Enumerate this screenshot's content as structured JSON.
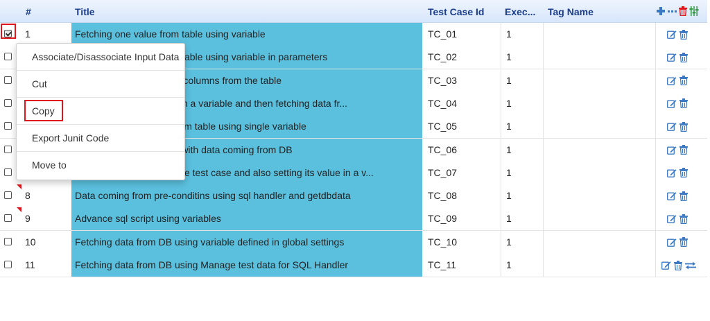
{
  "header": {
    "num": "#",
    "title": "Title",
    "tc_id": "Test Case Id",
    "exec": "Exec...",
    "tag": "Tag Name"
  },
  "rows": [
    {
      "num": "1",
      "title": "Fetching one value from table using variable",
      "tc": "TC_01",
      "exec": "1",
      "checked": true,
      "flag": false
    },
    {
      "num": "2",
      "title": "Fetching one value from table using variable in parameters",
      "tc": "TC_02",
      "exec": "1",
      "checked": false,
      "flag": false
    },
    {
      "num": "3",
      "title": "Fetching data of multiple columns from the table",
      "tc": "TC_03",
      "exec": "1",
      "checked": false,
      "flag": false
    },
    {
      "num": "4",
      "title": "Storing value from table in a variable and then fetching data fr...",
      "tc": "TC_04",
      "exec": "1",
      "checked": false,
      "flag": false
    },
    {
      "num": "5",
      "title": "Fetching multiple data from table using single variable",
      "tc": "TC_05",
      "exec": "1",
      "checked": false,
      "flag": false
    },
    {
      "num": "6",
      "title": "Comparing data of table with data coming from DB",
      "tc": "TC_06",
      "exec": "1",
      "checked": false,
      "flag": false
    },
    {
      "num": "7",
      "title": "Defining the variable in the test case and also setting its value in a v...",
      "tc": "TC_07",
      "exec": "1",
      "checked": false,
      "flag": false
    },
    {
      "num": "8",
      "title": "Data coming from pre-conditins using sql handler and getdbdata",
      "tc": "TC_08",
      "exec": "1",
      "checked": false,
      "flag": true
    },
    {
      "num": "9",
      "title": "Advance sql script using variables",
      "tc": "TC_09",
      "exec": "1",
      "checked": false,
      "flag": true
    },
    {
      "num": "10",
      "title": "Fetching data from DB using variable defined in global settings",
      "tc": "TC_10",
      "exec": "1",
      "checked": false,
      "flag": false
    },
    {
      "num": "11",
      "title": "Fetching data from DB using Manage test data for SQL Handler",
      "tc": "TC_11",
      "exec": "1",
      "checked": false,
      "flag": false
    }
  ],
  "context_menu": {
    "items": [
      "Associate/Disassociate Input Data",
      "Cut",
      "Copy",
      "Export Junit Code",
      "Move to"
    ],
    "highlighted": "Copy"
  },
  "icons": {
    "header": [
      "plus-icon",
      "more-icon",
      "trash-icon",
      "column-settings-icon"
    ],
    "row": [
      "edit-icon",
      "trash-icon"
    ],
    "row_last_extra": "swap-icon"
  },
  "colors": {
    "title_cell": "#5bc0de",
    "header_text": "#1c3d8a",
    "icon_blue": "#3a78c3",
    "danger": "#e0161f",
    "highlight_border": "#e0161f"
  }
}
